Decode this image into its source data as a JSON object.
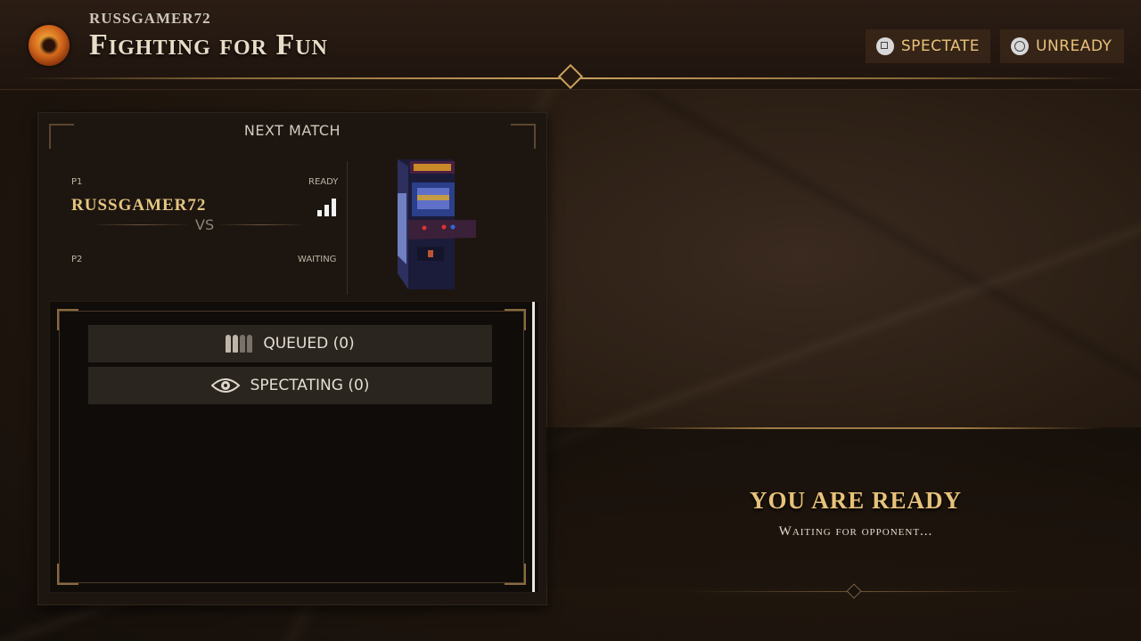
{
  "header": {
    "gamertag": "RUSSGAMER72",
    "lobby_title": "Fighting for Fun",
    "logo_icon": "dragon-logo-icon"
  },
  "actions": {
    "spectate_label": "SPECTATE",
    "spectate_icon": "square-button-icon",
    "unready_label": "UNREADY",
    "unready_icon": "circle-button-icon"
  },
  "next_match": {
    "title": "NEXT MATCH",
    "p1_label": "P1",
    "p1_name": "RUSSGAMER72",
    "p1_status": "READY",
    "vs_label": "VS",
    "p2_label": "P2",
    "p2_status": "WAITING"
  },
  "lists": {
    "queued_label": "QUEUED (0)",
    "spectating_label": "SPECTATING (0)"
  },
  "status": {
    "title": "YOU ARE READY",
    "subtitle": "Waiting for opponent..."
  },
  "colors": {
    "accent_gold": "#e7c27a",
    "background": "#1d1610"
  }
}
